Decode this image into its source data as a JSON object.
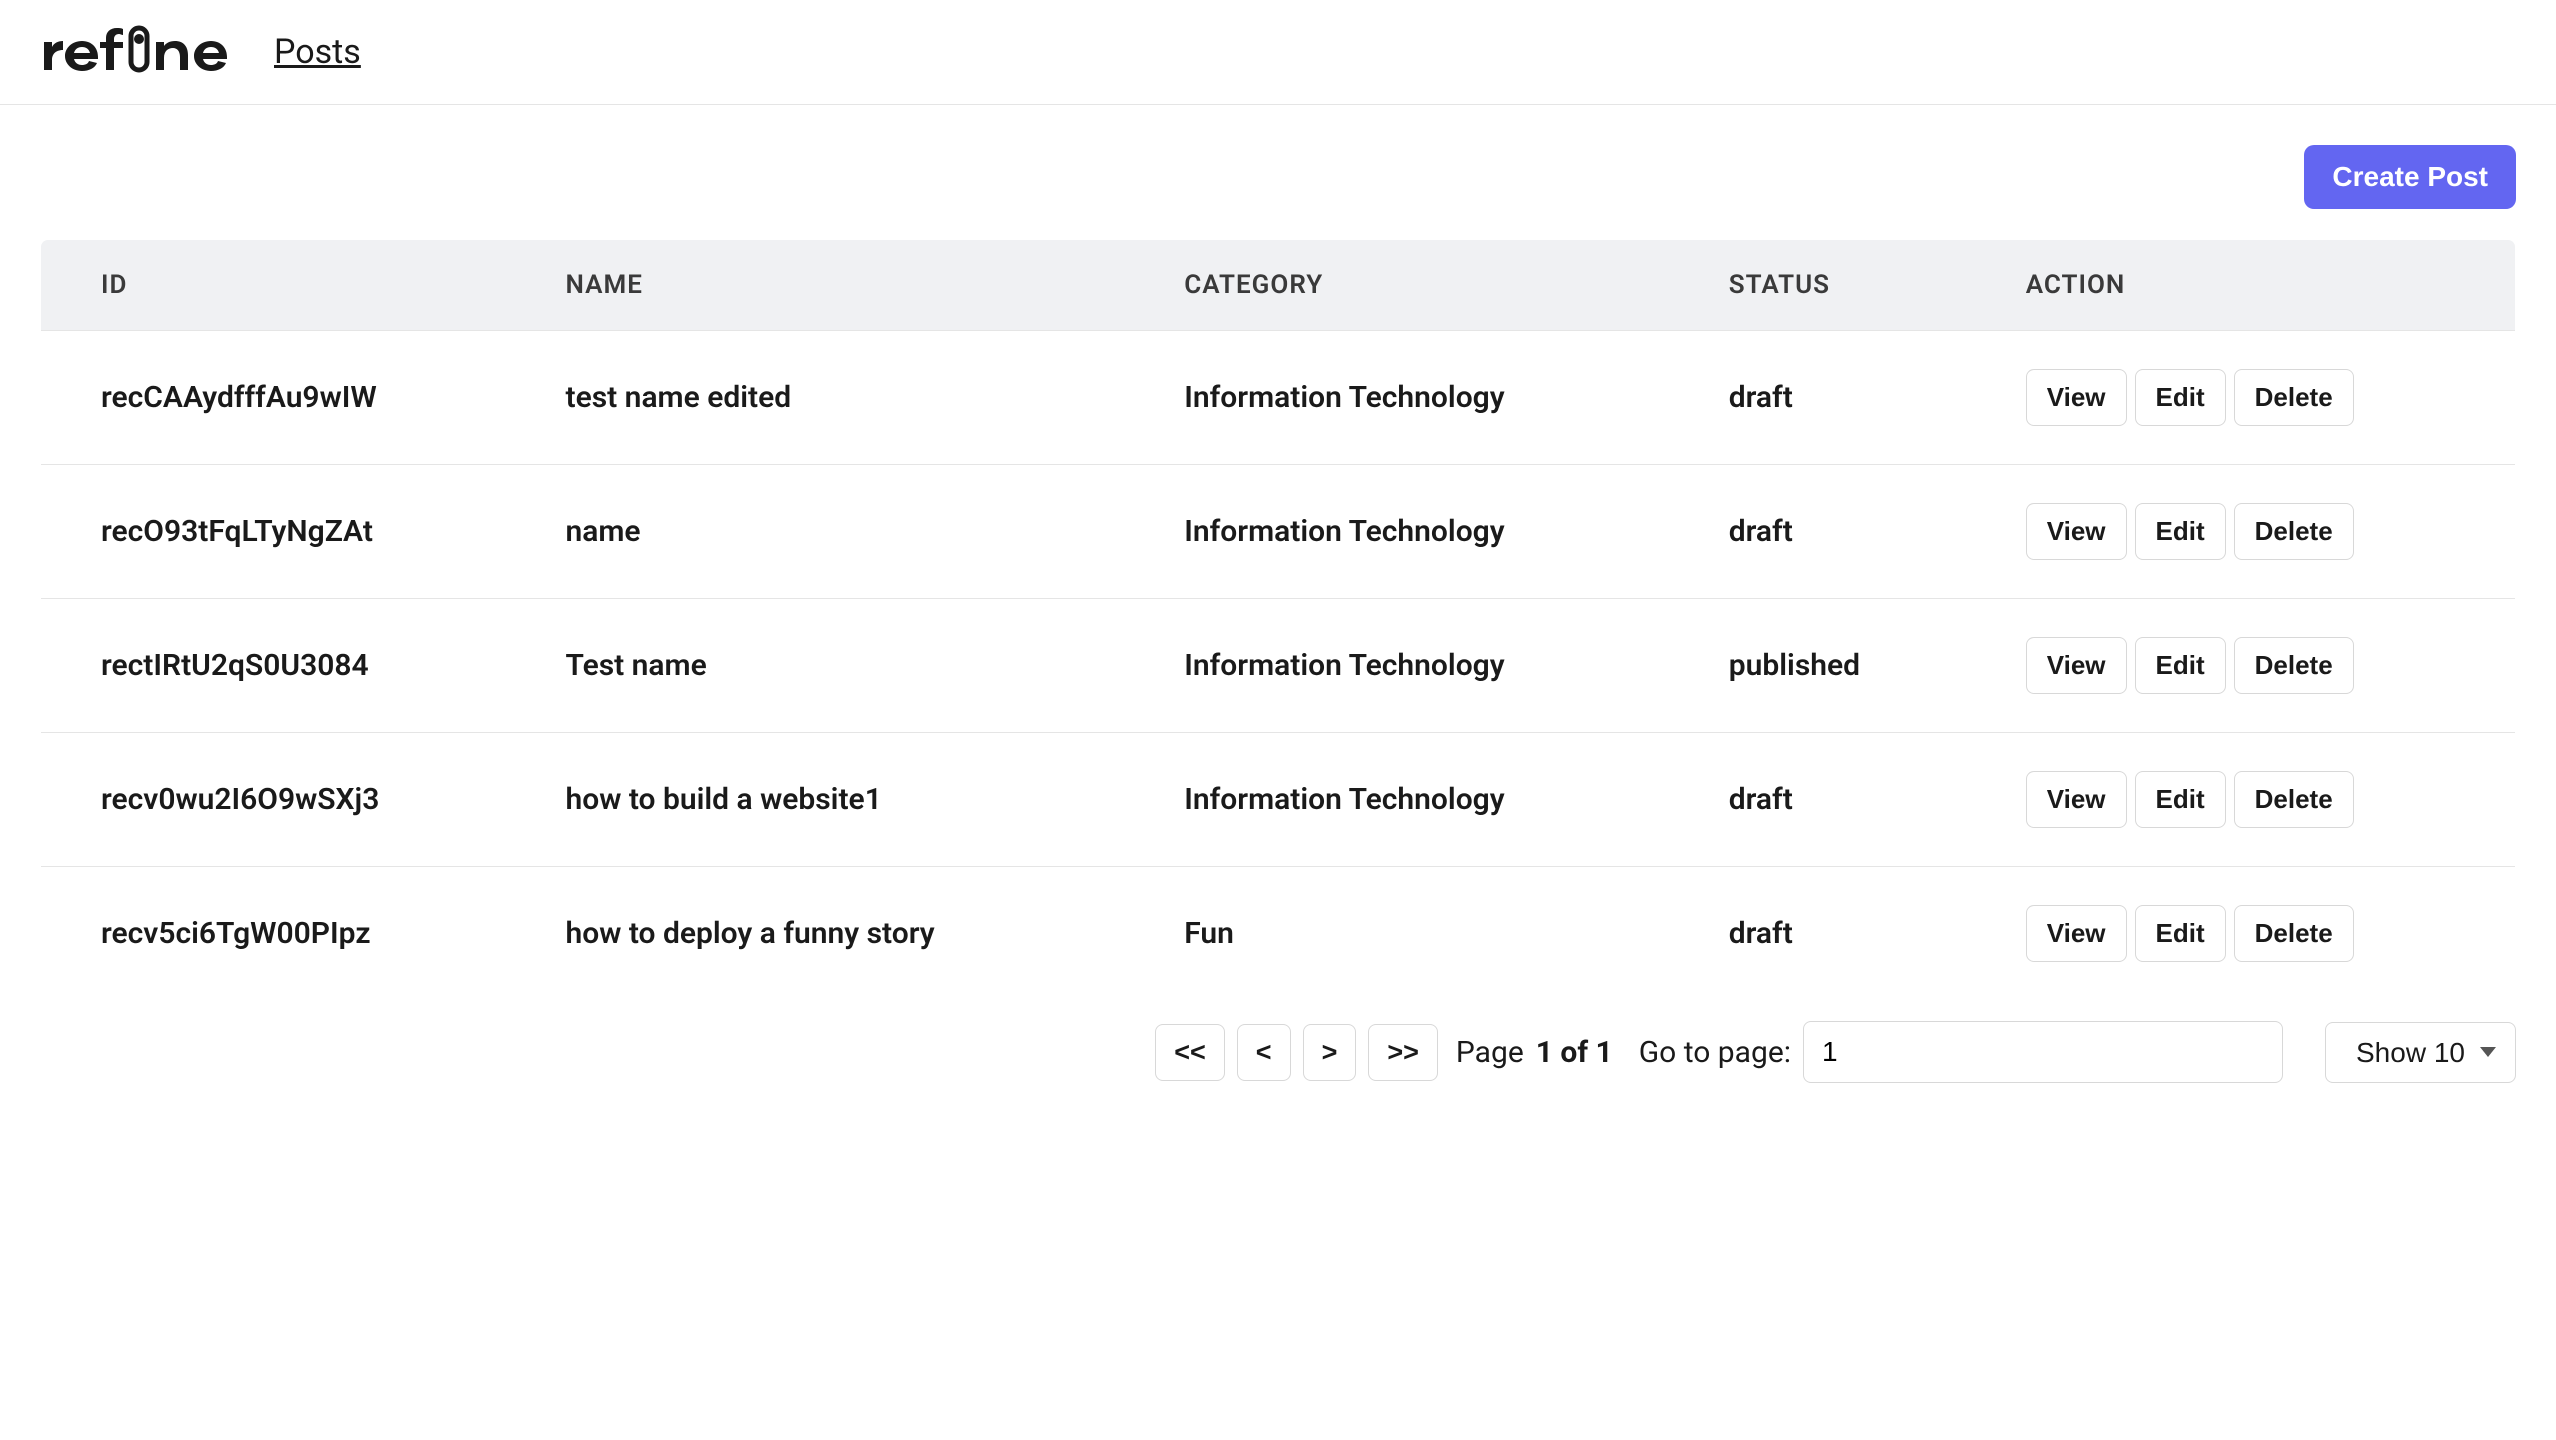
{
  "header": {
    "nav_link": "Posts"
  },
  "toolbar": {
    "create_label": "Create Post"
  },
  "table": {
    "columns": {
      "id": "ID",
      "name": "NAME",
      "category": "CATEGORY",
      "status": "STATUS",
      "action": "ACTION"
    },
    "actions": {
      "view": "View",
      "edit": "Edit",
      "delete": "Delete"
    },
    "rows": [
      {
        "id": "recCAAydfffAu9wIW",
        "name": "test name edited",
        "category": "Information Technology",
        "status": "draft"
      },
      {
        "id": "recO93tFqLTyNgZAt",
        "name": "name",
        "category": "Information Technology",
        "status": "draft"
      },
      {
        "id": "rectIRtU2qS0U3084",
        "name": "Test name",
        "category": "Information Technology",
        "status": "published"
      },
      {
        "id": "recv0wu2I6O9wSXj3",
        "name": "how to build a website1",
        "category": "Information Technology",
        "status": "draft"
      },
      {
        "id": "recv5ci6TgW00PIpz",
        "name": "how to deploy a funny story",
        "category": "Fun",
        "status": "draft"
      }
    ]
  },
  "pagination": {
    "first": "<<",
    "prev": "<",
    "next": ">",
    "last": ">>",
    "page_label": "Page",
    "page_count": "1 of 1",
    "goto_label": "Go to page:",
    "goto_value": "1",
    "show_label": "Show 10"
  }
}
